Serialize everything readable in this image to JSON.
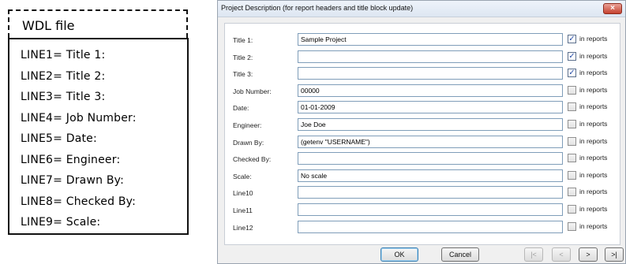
{
  "wdl": {
    "title": "WDL file",
    "lines": [
      "LINE1= Title 1:",
      "LINE2= Title 2:",
      "LINE3= Title 3:",
      "LINE4= Job Number:",
      "LINE5= Date:",
      "LINE6= Engineer:",
      "LINE7= Drawn By:",
      "LINE8= Checked By:",
      "LINE9= Scale:"
    ]
  },
  "dialog": {
    "title": "Project Description  (for report headers and title block update)",
    "close_label": "×",
    "check_label": "in reports",
    "fields": [
      {
        "label": "Title 1:",
        "value": "Sample Project",
        "checked": true
      },
      {
        "label": "Title 2:",
        "value": "",
        "checked": true
      },
      {
        "label": "Title 3:",
        "value": "",
        "checked": true
      },
      {
        "label": "Job Number:",
        "value": "00000",
        "checked": false
      },
      {
        "label": "Date:",
        "value": "01-01-2009",
        "checked": false
      },
      {
        "label": "Engineer:",
        "value": "Joe Doe",
        "checked": false
      },
      {
        "label": "Drawn By:",
        "value": "(getenv \"USERNAME\")",
        "checked": false
      },
      {
        "label": "Checked By:",
        "value": "",
        "checked": false
      },
      {
        "label": "Scale:",
        "value": "No scale",
        "checked": false
      },
      {
        "label": "Line10",
        "value": "",
        "checked": false
      },
      {
        "label": "Line11",
        "value": "",
        "checked": false
      },
      {
        "label": "Line12",
        "value": "",
        "checked": false
      }
    ],
    "buttons": {
      "ok": "OK",
      "cancel": "Cancel",
      "first": "|<",
      "prev": "<",
      "next": ">",
      "last": ">|"
    }
  }
}
